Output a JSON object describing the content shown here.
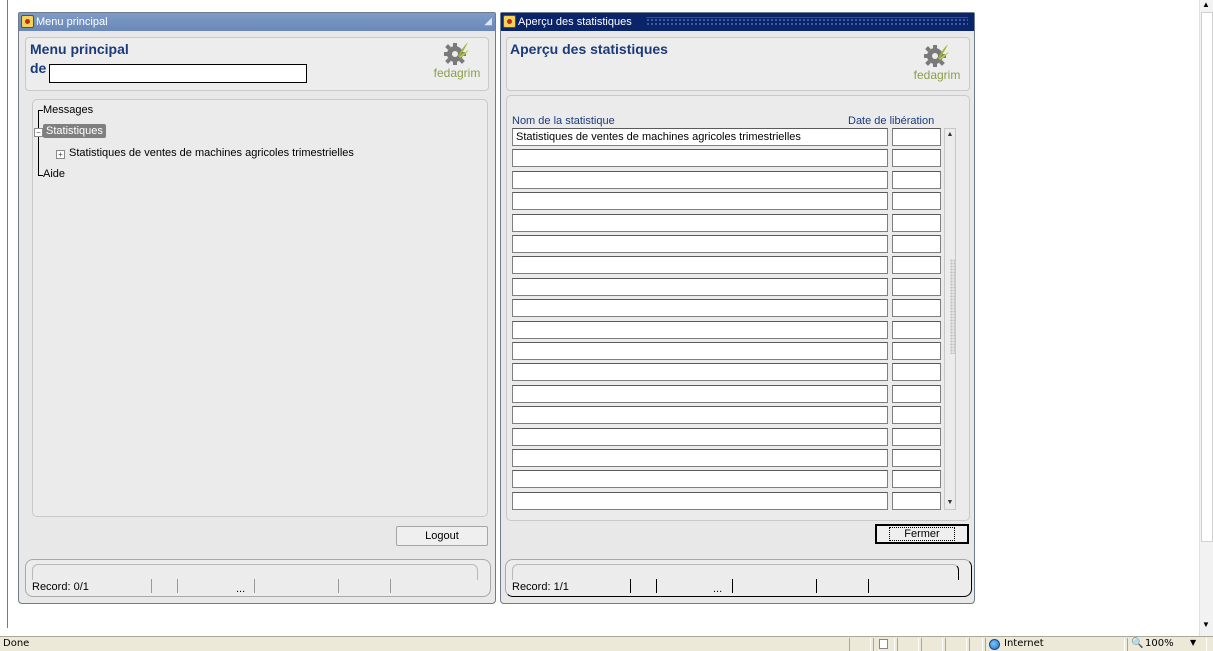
{
  "left_window": {
    "title": "Menu principal",
    "header_title": "Menu principal",
    "de_label": "de",
    "de_value": "",
    "logo_text": "fedagrim",
    "tree": {
      "messages": "Messages",
      "statistiques": "Statistiques",
      "stats_child": "Statistiques de ventes de machines agricoles trimestrielles",
      "aide": "Aide"
    },
    "logout_label": "Logout",
    "record_text": "Record: 0/1",
    "status_ellipsis": "..."
  },
  "right_window": {
    "title": "Aperçu des statistiques",
    "header_title": "Aperçu des statistiques",
    "logo_text": "fedagrim",
    "col_name_header": "Nom de la  statistique",
    "col_date_header": "Date de libération",
    "rows": [
      {
        "name": "Statistiques de ventes de machines agricoles trimestrielles",
        "date": ""
      },
      {
        "name": "",
        "date": ""
      },
      {
        "name": "",
        "date": ""
      },
      {
        "name": "",
        "date": ""
      },
      {
        "name": "",
        "date": ""
      },
      {
        "name": "",
        "date": ""
      },
      {
        "name": "",
        "date": ""
      },
      {
        "name": "",
        "date": ""
      },
      {
        "name": "",
        "date": ""
      },
      {
        "name": "",
        "date": ""
      },
      {
        "name": "",
        "date": ""
      },
      {
        "name": "",
        "date": ""
      },
      {
        "name": "",
        "date": ""
      },
      {
        "name": "",
        "date": ""
      },
      {
        "name": "",
        "date": ""
      },
      {
        "name": "",
        "date": ""
      },
      {
        "name": "",
        "date": ""
      },
      {
        "name": "",
        "date": ""
      }
    ],
    "close_label": "Fermer",
    "record_text": "Record: 1/1",
    "status_ellipsis": "..."
  },
  "browser_status": {
    "done_text": "Done",
    "zone_text": "Internet",
    "zoom_text": "100%"
  },
  "colors": {
    "title_active": "#0a246a",
    "title_inactive": "#7f9bc6",
    "header_text": "#1b3a7a",
    "logo_green": "#8aa04a"
  }
}
